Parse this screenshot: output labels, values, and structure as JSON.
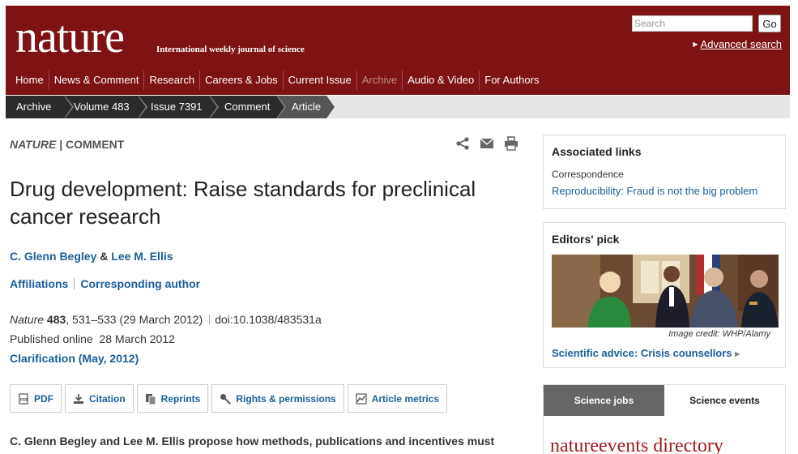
{
  "header": {
    "logo": "nature",
    "tagline": "International weekly journal of science",
    "search_placeholder": "Search",
    "go_label": "Go",
    "advanced_search": "Advanced search",
    "nav": [
      {
        "label": "Home"
      },
      {
        "label": "News & Comment"
      },
      {
        "label": "Research"
      },
      {
        "label": "Careers & Jobs"
      },
      {
        "label": "Current Issue"
      },
      {
        "label": "Archive"
      },
      {
        "label": "Audio & Video"
      },
      {
        "label": "For Authors"
      }
    ]
  },
  "breadcrumb": [
    "Archive",
    "Volume 483",
    "Issue 7391",
    "Comment",
    "Article"
  ],
  "article": {
    "journal": "NATURE",
    "section": "COMMENT",
    "title": "Drug development: Raise standards for preclinical cancer research",
    "author1": "C. Glenn Begley",
    "and": "&",
    "author2": "Lee M. Ellis",
    "affiliations": "Affiliations",
    "corresponding": "Corresponding author",
    "citation": {
      "journal": "Nature",
      "volume": "483",
      "pages": ", 531–533",
      "date": "(29 March 2012)",
      "doi": "doi:10.1038/483531a"
    },
    "published": "Published online  28 March 2012",
    "clarification": "Clarification (May, 2012)",
    "tools": [
      "PDF",
      "Citation",
      "Reprints",
      "Rights & permissions",
      "Article metrics"
    ],
    "standfirst": "C. Glenn Begley and Lee M. Ellis propose how methods, publications and incentives must"
  },
  "sidebar": {
    "associated": {
      "heading": "Associated links",
      "sub": "Correspondence",
      "link": "Reproducibility: Fraud is not the big problem"
    },
    "editors_pick": {
      "heading": "Editors' pick",
      "credit": "Image credit: WHP/Alamy",
      "link": "Scientific advice: Crisis counsellors"
    },
    "tabs": {
      "jobs": "Science jobs",
      "events": "Science events"
    },
    "events_logo_a": "nature",
    "events_logo_b": "events directory"
  },
  "colors": {
    "header_bg": "#7d1315",
    "link": "#1a5d9b",
    "breadcrumb_bg": "#2b2b2b"
  }
}
